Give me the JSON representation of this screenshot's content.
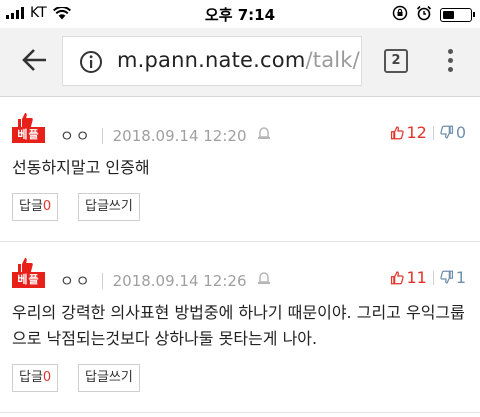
{
  "status_bar": {
    "carrier": "KT",
    "time": "오후 7:14"
  },
  "browser": {
    "url_host": "m.pann.nate.com",
    "url_path": "/talk/rep",
    "tab_count": "2"
  },
  "comments": [
    {
      "badge": "베플",
      "author": "ㅇㅇ",
      "date": "2018.09.14 12:20",
      "upvotes": "12",
      "downvotes": "0",
      "text": "선동하지말고 인증해",
      "reply_label": "답글",
      "reply_count": "0",
      "write_reply_label": "답글쓰기"
    },
    {
      "badge": "베플",
      "author": "ㅇㅇ",
      "date": "2018.09.14 12:26",
      "upvotes": "11",
      "downvotes": "1",
      "text": "우리의 강력한 의사표현 방법중에 하나기 때문이야. 그리고 우익그룹으로 낙점되는것보다 상하나둘 못타는게 나아.",
      "reply_label": "답글",
      "reply_count": "0",
      "write_reply_label": "답글쓰기"
    }
  ],
  "colors": {
    "accent_red": "#e8201a",
    "downvote_blue": "#6f8fad"
  }
}
